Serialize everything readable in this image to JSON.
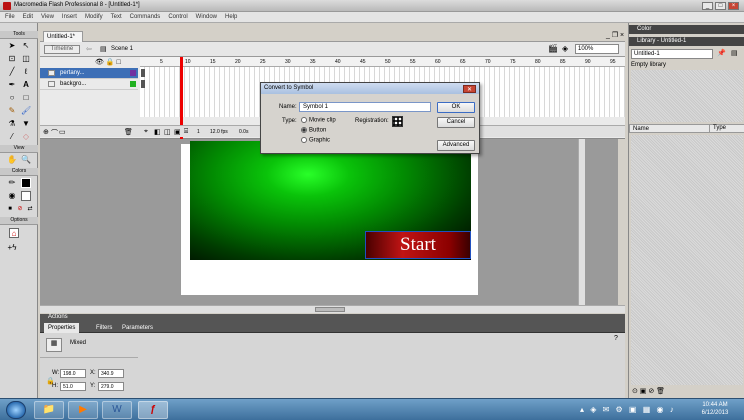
{
  "window": {
    "title": "Macromedia Flash Professional 8 - [Untitled-1*]",
    "min": "_",
    "max": "□",
    "close": "×"
  },
  "menu": [
    "File",
    "Edit",
    "View",
    "Insert",
    "Modify",
    "Text",
    "Commands",
    "Control",
    "Window",
    "Help"
  ],
  "tools": {
    "label": "Tools",
    "view_label": "View",
    "colors_label": "Colors",
    "options_label": "Options"
  },
  "document": {
    "tab": "Untitled-1*",
    "timeline_btn": "Timeline",
    "scene": "Scene 1",
    "zoom": "100%"
  },
  "timeline": {
    "layers": [
      {
        "name": "pertany..."
      },
      {
        "name": "backgro..."
      }
    ],
    "frame": "1",
    "fps": "12.0 fps",
    "time": "0.0s",
    "ruler": [
      "5",
      "10",
      "15",
      "20",
      "25",
      "30",
      "35",
      "40",
      "45",
      "50",
      "55",
      "60",
      "65",
      "70",
      "75",
      "80",
      "85",
      "90",
      "95"
    ]
  },
  "stage": {
    "button_text": "Start"
  },
  "panels": {
    "actions": "Actions",
    "tabs": [
      "Properties",
      "Filters",
      "Parameters"
    ]
  },
  "properties": {
    "mode": "Mixed",
    "w_label": "W:",
    "w": "198.0",
    "h_label": "H:",
    "h": "51.0",
    "x_label": "X:",
    "x": "340.9",
    "y_label": "Y:",
    "y": "279.0"
  },
  "right_panel": {
    "color_title": "Color",
    "library_title": "Library - Untitled-1",
    "library_select": "Untitled-1",
    "library_status": "Empty library",
    "col_name": "Name",
    "col_type": "Type"
  },
  "dialog": {
    "title": "Convert to Symbol",
    "name_label": "Name:",
    "name_value": "Symbol 1",
    "type_label": "Type:",
    "options": [
      "Movie clip",
      "Button",
      "Graphic"
    ],
    "selected": "Button",
    "registration_label": "Registration:",
    "ok": "OK",
    "cancel": "Cancel",
    "advanced": "Advanced"
  },
  "taskbar": {
    "time": "10:44 AM",
    "date": "6/12/2013"
  }
}
